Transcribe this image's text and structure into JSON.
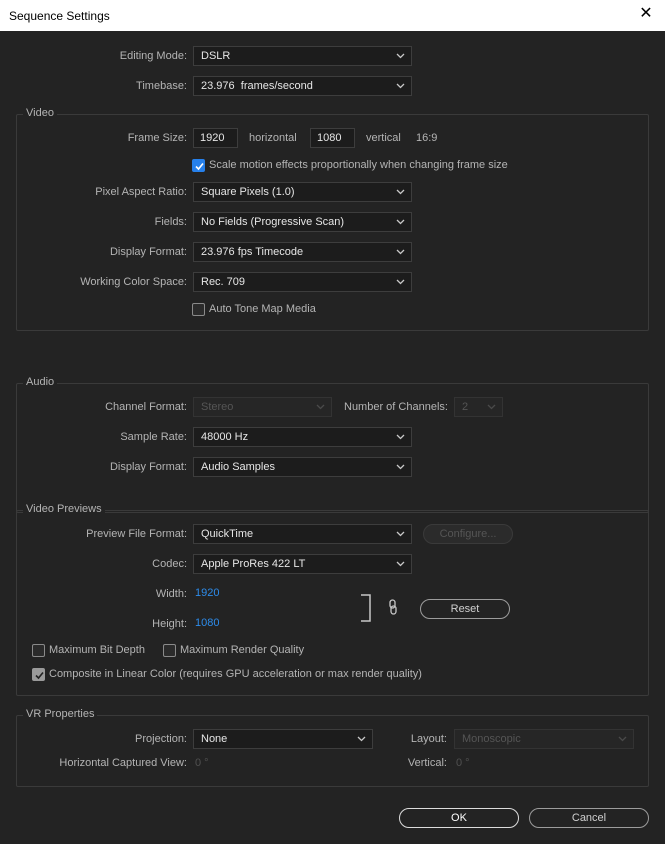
{
  "window": {
    "title": "Sequence Settings"
  },
  "general": {
    "editing_mode_label": "Editing Mode:",
    "editing_mode_value": "DSLR",
    "timebase_label": "Timebase:",
    "timebase_value": "23.976  frames/second"
  },
  "video": {
    "group_label": "Video",
    "frame_size_label": "Frame Size:",
    "frame_width": "1920",
    "horizontal_label": "horizontal",
    "frame_height": "1080",
    "vertical_label": "vertical",
    "aspect": "16:9",
    "scale_motion_label": "Scale motion effects proportionally when changing frame size",
    "scale_motion_checked": true,
    "pixel_aspect_label": "Pixel Aspect Ratio:",
    "pixel_aspect_value": "Square Pixels (1.0)",
    "fields_label": "Fields:",
    "fields_value": "No Fields (Progressive Scan)",
    "display_format_label": "Display Format:",
    "display_format_value": "23.976 fps Timecode",
    "color_space_label": "Working Color Space:",
    "color_space_value": "Rec. 709",
    "auto_tone_label": "Auto Tone Map Media",
    "auto_tone_checked": false
  },
  "audio": {
    "group_label": "Audio",
    "channel_format_label": "Channel Format:",
    "channel_format_value": "Stereo",
    "num_channels_label": "Number of Channels:",
    "num_channels_value": "2",
    "sample_rate_label": "Sample Rate:",
    "sample_rate_value": "48000 Hz",
    "display_format_label": "Display Format:",
    "display_format_value": "Audio Samples"
  },
  "previews": {
    "group_label": "Video Previews",
    "file_format_label": "Preview File Format:",
    "file_format_value": "QuickTime",
    "configure_label": "Configure...",
    "codec_label": "Codec:",
    "codec_value": "Apple ProRes 422 LT",
    "width_label": "Width:",
    "width_value": "1920",
    "height_label": "Height:",
    "height_value": "1080",
    "reset_label": "Reset",
    "max_bit_depth_label": "Maximum Bit Depth",
    "max_render_quality_label": "Maximum Render Quality",
    "composite_label": "Composite in Linear Color (requires GPU acceleration or max render quality)",
    "composite_checked": true
  },
  "vr": {
    "group_label": "VR Properties",
    "projection_label": "Projection:",
    "projection_value": "None",
    "layout_label": "Layout:",
    "layout_value": "Monoscopic",
    "h_view_label": "Horizontal Captured View:",
    "h_view_value": "0 °",
    "vertical_label": "Vertical:",
    "vertical_value": "0 °"
  },
  "footer": {
    "ok_label": "OK",
    "cancel_label": "Cancel"
  },
  "colors": {
    "accent": "#2680eb",
    "background": "#232323",
    "field": "#1c1c1c"
  }
}
